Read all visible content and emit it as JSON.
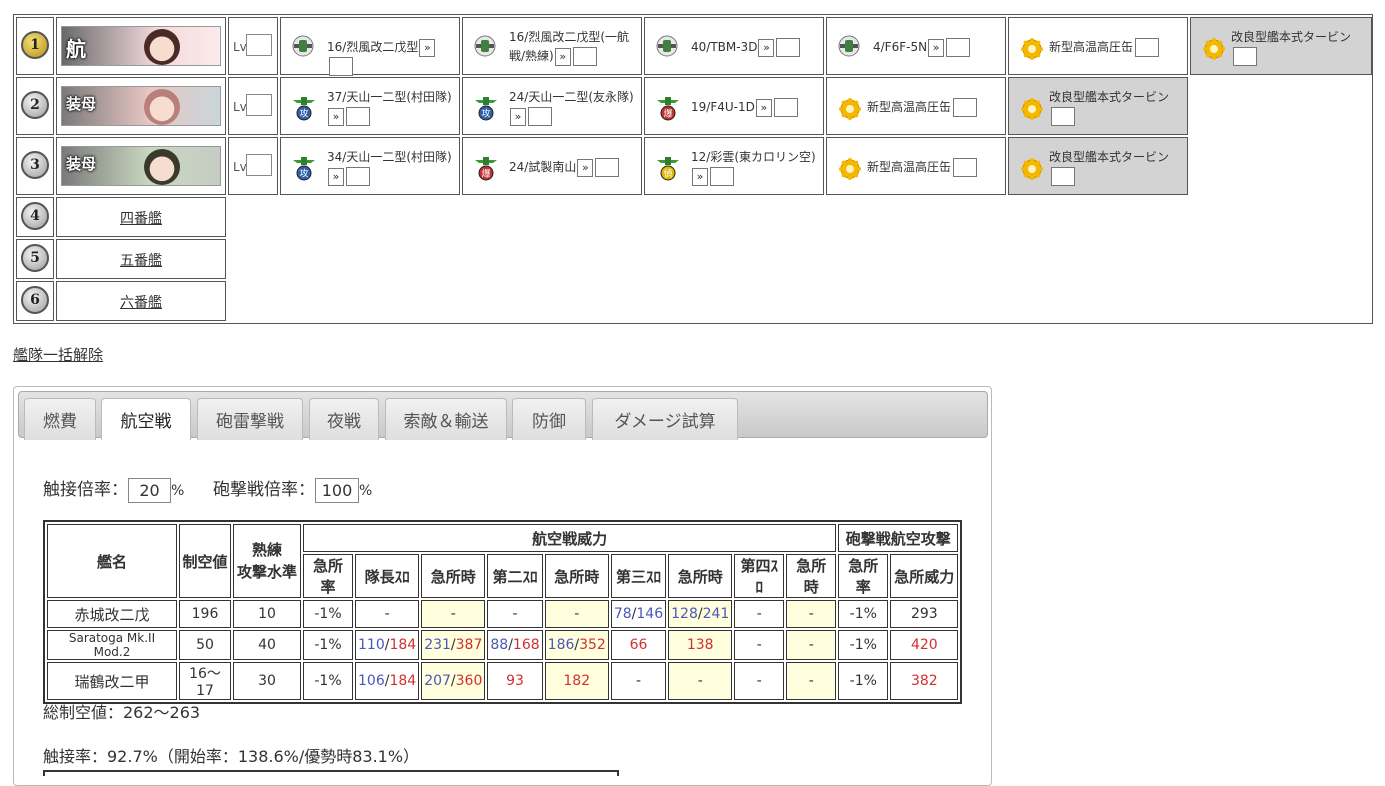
{
  "fleet": {
    "lv_label": "Lv",
    "raquo": "»",
    "rows": [
      {
        "num": "1",
        "ship_tag": "航",
        "equips": [
          {
            "text": "16/烈風改二戊型",
            "icon": "fighter-icon"
          },
          {
            "text": "16/烈風改二戊型(一航戦/熟練)",
            "icon": "fighter-icon"
          },
          {
            "text": "40/TBM-3D",
            "icon": "fighter-icon"
          },
          {
            "text": "4/F6F-5N",
            "icon": "fighter-icon"
          },
          {
            "text": "新型高温高圧缶",
            "icon": "boiler-icon"
          },
          {
            "text": "改良型艦本式タービン",
            "icon": "turbine-icon"
          }
        ]
      },
      {
        "num": "2",
        "ship_tag": "装母",
        "equips": [
          {
            "text": "37/天山一二型(村田隊)",
            "icon": "torpedo-bomber-icon"
          },
          {
            "text": "24/天山一二型(友永隊)",
            "icon": "torpedo-bomber-icon"
          },
          {
            "text": "19/F4U-1D",
            "icon": "dive-bomber-icon"
          },
          {
            "text": "新型高温高圧缶",
            "icon": "boiler-icon"
          },
          {
            "text": "改良型艦本式タービン",
            "icon": "turbine-icon"
          }
        ]
      },
      {
        "num": "3",
        "ship_tag": "装母",
        "equips": [
          {
            "text": "34/天山一二型(村田隊)",
            "icon": "torpedo-bomber-icon"
          },
          {
            "text": "24/試製南山",
            "icon": "dive-bomber-icon"
          },
          {
            "text": "12/彩雲(東カロリン空)",
            "icon": "recon-icon"
          },
          {
            "text": "新型高温高圧缶",
            "icon": "boiler-icon"
          },
          {
            "text": "改良型艦本式タービン",
            "icon": "turbine-icon"
          }
        ]
      }
    ],
    "empty_slots": [
      {
        "num": "4",
        "label": "四番艦"
      },
      {
        "num": "5",
        "label": "五番艦"
      },
      {
        "num": "6",
        "label": "六番艦"
      }
    ]
  },
  "bulk_release": "艦隊一括解除",
  "tabs": [
    {
      "label": "燃費",
      "active": false
    },
    {
      "label": "航空戦",
      "active": true
    },
    {
      "label": "砲雷撃戦",
      "active": false
    },
    {
      "label": "夜戦",
      "active": false
    },
    {
      "label": "索敵＆輸送",
      "active": false
    },
    {
      "label": "防御",
      "active": false
    },
    {
      "label": "ダメージ試算",
      "active": false
    }
  ],
  "rates": {
    "contact_label": "触接倍率：",
    "contact_value": "20",
    "shelling_label": "砲撃戦倍率：",
    "shelling_value": "100",
    "unit": "%"
  },
  "air_table": {
    "headers": {
      "name": "艦名",
      "air_power": "制空値",
      "skill_1": "熟練",
      "skill_2": "攻撃水準",
      "air_battle": "航空戦威力",
      "shelling_air": "砲撃戦航空攻撃",
      "sub": [
        "急所率",
        "隊長ｽﾛ",
        "急所時",
        "第二ｽﾛ",
        "急所時",
        "第三ｽﾛ",
        "急所時",
        "第四ｽﾛ",
        "急所時",
        "急所率",
        "急所威力"
      ]
    },
    "rows": [
      {
        "name": "赤城改二戊",
        "air": "196",
        "skill": "10",
        "cells": [
          [
            "-1%"
          ],
          [
            "-"
          ],
          [
            "-"
          ],
          [
            "-"
          ],
          [
            "-"
          ],
          [
            "78",
            "146"
          ],
          [
            "128",
            "241"
          ],
          [
            "-"
          ],
          [
            "-"
          ],
          [
            "-1%"
          ],
          [
            "293"
          ]
        ]
      },
      {
        "name": "Saratoga Mk.II Mod.2",
        "air": "50",
        "skill": "40",
        "cells": [
          [
            "-1%"
          ],
          [
            "110",
            "184"
          ],
          [
            "231",
            "387"
          ],
          [
            "88",
            "168"
          ],
          [
            "186",
            "352"
          ],
          [
            "66"
          ],
          [
            "138"
          ],
          [
            "-"
          ],
          [
            "-"
          ],
          [
            "-1%"
          ],
          [
            "420"
          ]
        ]
      },
      {
        "name": "瑞鶴改二甲",
        "air": "16～17",
        "skill": "30",
        "cells": [
          [
            "-1%"
          ],
          [
            "106",
            "184"
          ],
          [
            "207",
            "360"
          ],
          [
            "93"
          ],
          [
            "182"
          ],
          [
            "-"
          ],
          [
            "-"
          ],
          [
            "-"
          ],
          [
            "-"
          ],
          [
            "-1%"
          ],
          [
            "382"
          ]
        ]
      }
    ]
  },
  "total_air": "総制空値：262～263",
  "contact_rate": "触接率：92.7%（開始率：138.6%/優勢時83.1%）",
  "colors": {
    "blue": "#4a58b8",
    "red": "#d23030",
    "green": "#4a9a40",
    "highlight": "#ffffdd",
    "equip_gray": "#d3d3d3"
  }
}
